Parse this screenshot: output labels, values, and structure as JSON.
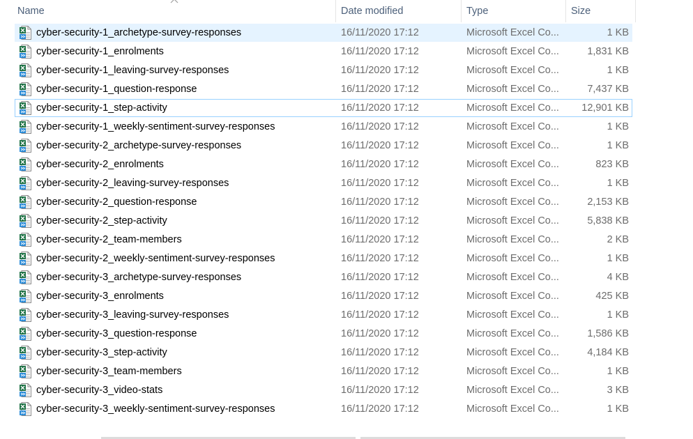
{
  "columns": {
    "name": "Name",
    "date": "Date modified",
    "type": "Type",
    "size": "Size"
  },
  "sort": {
    "column": "name",
    "direction": "ascending",
    "icon": "chevron-up-icon"
  },
  "icon": "excel-file-icon",
  "colors": {
    "header_text": "#4c607a",
    "selected_bg": "#e5f3ff",
    "focus_border": "#99d1ff",
    "excel_green": "#1e7145"
  },
  "files": [
    {
      "name": "cyber-security-1_archetype-survey-responses",
      "date": "16/11/2020 17:12",
      "type": "Microsoft Excel Co...",
      "size": "1 KB",
      "selected": true
    },
    {
      "name": "cyber-security-1_enrolments",
      "date": "16/11/2020 17:12",
      "type": "Microsoft Excel Co...",
      "size": "1,831 KB"
    },
    {
      "name": "cyber-security-1_leaving-survey-responses",
      "date": "16/11/2020 17:12",
      "type": "Microsoft Excel Co...",
      "size": "1 KB"
    },
    {
      "name": "cyber-security-1_question-response",
      "date": "16/11/2020 17:12",
      "type": "Microsoft Excel Co...",
      "size": "7,437 KB"
    },
    {
      "name": "cyber-security-1_step-activity",
      "date": "16/11/2020 17:12",
      "type": "Microsoft Excel Co...",
      "size": "12,901 KB",
      "focused": true
    },
    {
      "name": "cyber-security-1_weekly-sentiment-survey-responses",
      "date": "16/11/2020 17:12",
      "type": "Microsoft Excel Co...",
      "size": "1 KB"
    },
    {
      "name": "cyber-security-2_archetype-survey-responses",
      "date": "16/11/2020 17:12",
      "type": "Microsoft Excel Co...",
      "size": "1 KB"
    },
    {
      "name": "cyber-security-2_enrolments",
      "date": "16/11/2020 17:12",
      "type": "Microsoft Excel Co...",
      "size": "823 KB"
    },
    {
      "name": "cyber-security-2_leaving-survey-responses",
      "date": "16/11/2020 17:12",
      "type": "Microsoft Excel Co...",
      "size": "1 KB"
    },
    {
      "name": "cyber-security-2_question-response",
      "date": "16/11/2020 17:12",
      "type": "Microsoft Excel Co...",
      "size": "2,153 KB"
    },
    {
      "name": "cyber-security-2_step-activity",
      "date": "16/11/2020 17:12",
      "type": "Microsoft Excel Co...",
      "size": "5,838 KB"
    },
    {
      "name": "cyber-security-2_team-members",
      "date": "16/11/2020 17:12",
      "type": "Microsoft Excel Co...",
      "size": "2 KB"
    },
    {
      "name": "cyber-security-2_weekly-sentiment-survey-responses",
      "date": "16/11/2020 17:12",
      "type": "Microsoft Excel Co...",
      "size": "1 KB"
    },
    {
      "name": "cyber-security-3_archetype-survey-responses",
      "date": "16/11/2020 17:12",
      "type": "Microsoft Excel Co...",
      "size": "4 KB"
    },
    {
      "name": "cyber-security-3_enrolments",
      "date": "16/11/2020 17:12",
      "type": "Microsoft Excel Co...",
      "size": "425 KB"
    },
    {
      "name": "cyber-security-3_leaving-survey-responses",
      "date": "16/11/2020 17:12",
      "type": "Microsoft Excel Co...",
      "size": "1 KB"
    },
    {
      "name": "cyber-security-3_question-response",
      "date": "16/11/2020 17:12",
      "type": "Microsoft Excel Co...",
      "size": "1,586 KB"
    },
    {
      "name": "cyber-security-3_step-activity",
      "date": "16/11/2020 17:12",
      "type": "Microsoft Excel Co...",
      "size": "4,184 KB"
    },
    {
      "name": "cyber-security-3_team-members",
      "date": "16/11/2020 17:12",
      "type": "Microsoft Excel Co...",
      "size": "1 KB"
    },
    {
      "name": "cyber-security-3_video-stats",
      "date": "16/11/2020 17:12",
      "type": "Microsoft Excel Co...",
      "size": "3 KB"
    },
    {
      "name": "cyber-security-3_weekly-sentiment-survey-responses",
      "date": "16/11/2020 17:12",
      "type": "Microsoft Excel Co...",
      "size": "1 KB"
    }
  ]
}
